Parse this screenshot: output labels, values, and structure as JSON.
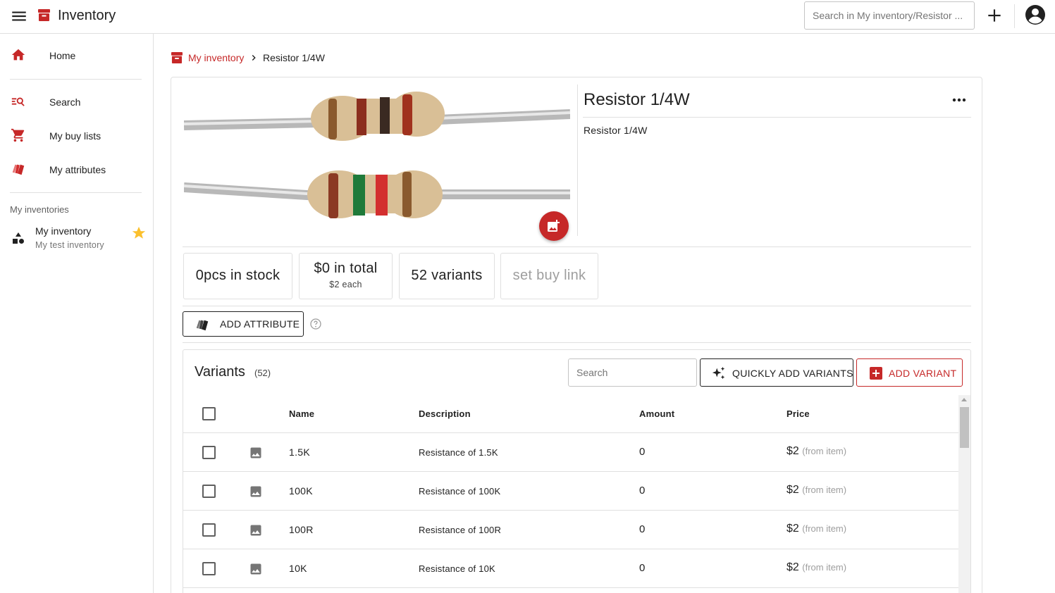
{
  "header": {
    "app_title": "Inventory",
    "search_placeholder": "Search in My inventory/Resistor ..."
  },
  "sidebar": {
    "items": [
      {
        "label": "Home",
        "icon": "home-icon"
      },
      {
        "label": "Search",
        "icon": "manage-search-icon"
      },
      {
        "label": "My buy lists",
        "icon": "cart-icon"
      },
      {
        "label": "My attributes",
        "icon": "attributes-icon"
      }
    ],
    "section_title": "My inventories",
    "inventory": {
      "name": "My inventory",
      "description": "My test inventory",
      "favorite": true
    }
  },
  "breadcrumb": {
    "root": "My inventory",
    "current": "Resistor 1/4W"
  },
  "item": {
    "title": "Resistor 1/4W",
    "description": "Resistor 1/4W"
  },
  "stats": {
    "stock": "0pcs in stock",
    "total": "$0 in total",
    "each": "$2 each",
    "variants": "52 variants",
    "buy_link": "set buy link"
  },
  "attribute_button": "ADD ATTRIBUTE",
  "variants": {
    "title": "Variants",
    "count": "(52)",
    "search_placeholder": "Search",
    "quick_add_label": "QUICKLY ADD VARIANTS",
    "add_label": "ADD VARIANT",
    "columns": {
      "name": "Name",
      "description": "Description",
      "amount": "Amount",
      "price": "Price"
    },
    "rows": [
      {
        "name": "1.5K",
        "description": "Resistance of 1.5K",
        "amount": "0",
        "price": "$2",
        "price_note": "(from item)"
      },
      {
        "name": "100K",
        "description": "Resistance of 100K",
        "amount": "0",
        "price": "$2",
        "price_note": "(from item)"
      },
      {
        "name": "100R",
        "description": "Resistance of 100R",
        "amount": "0",
        "price": "$2",
        "price_note": "(from item)"
      },
      {
        "name": "10K",
        "description": "Resistance of 10K",
        "amount": "0",
        "price": "$2",
        "price_note": "(from item)"
      }
    ]
  },
  "colors": {
    "accent": "#c62828",
    "star": "#fbc02d",
    "border": "#e0e0e0"
  }
}
